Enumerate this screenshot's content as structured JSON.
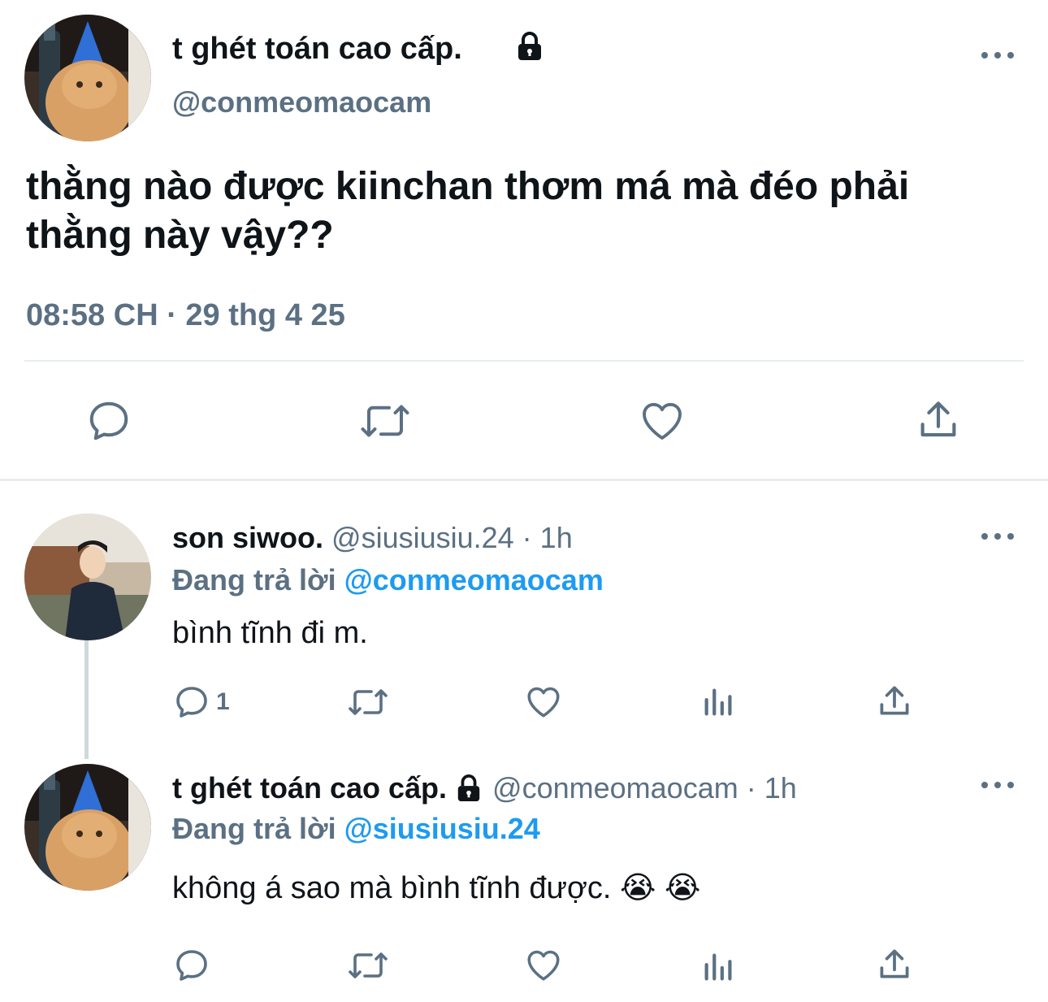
{
  "main_tweet": {
    "display_name": "t ghét toán cao cấp.",
    "handle": "@conmeomaocam",
    "text_line1": "thằng nào được kiinchan thơm má mà đéo phải",
    "text_line2": "thằng này vậy??",
    "timestamp": "08:58 CH · 29 thg 4 25",
    "actions": [
      "reply-icon",
      "retweet-icon",
      "like-icon",
      "share-icon"
    ]
  },
  "replies": [
    {
      "display_name": "son siwoo.",
      "meta": "@siusiusiu.24 · 1h",
      "replying_prefix": "Đang trả lời",
      "replying_to": "@conmeomaocam",
      "text": "bình tĩnh đi m.",
      "reply_count": "1"
    },
    {
      "display_name": "t ghét toán cao cấp.",
      "meta": "@conmeomaocam · 1h",
      "replying_prefix": "Đang trả lời",
      "replying_to": "@siusiusiu.24",
      "text": "không á sao mà bình tĩnh được.",
      "emoji": "😭 😭"
    }
  ],
  "colors": {
    "text": "#0f1419",
    "secondary": "#5b7083",
    "link": "#1d9bf0",
    "divider": "#e6ecf0"
  }
}
